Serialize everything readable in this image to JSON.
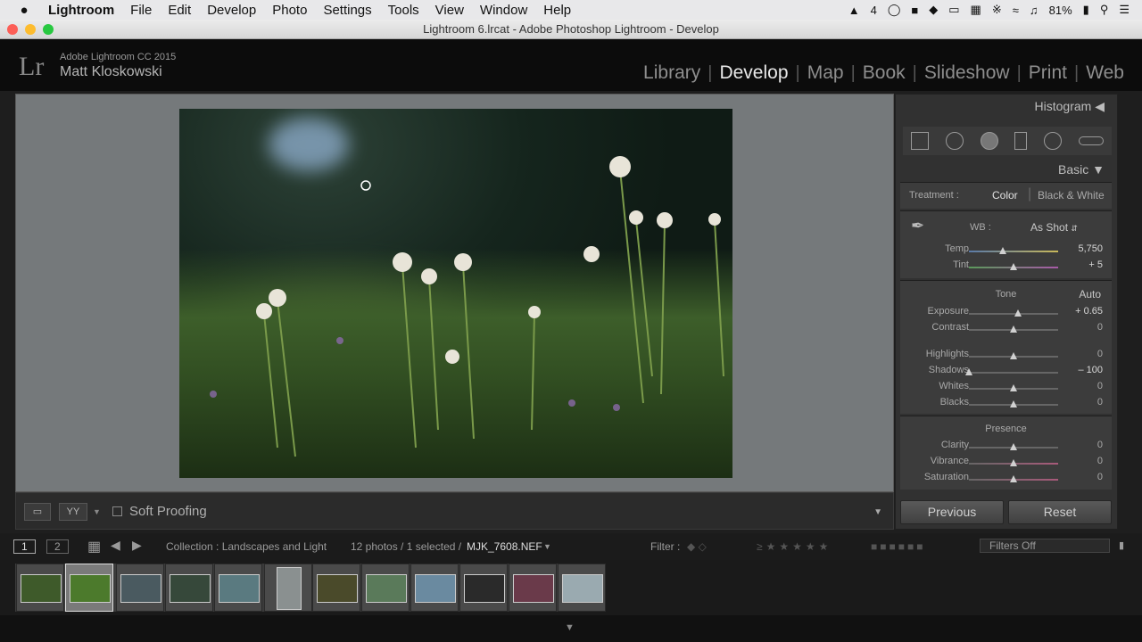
{
  "menubar": {
    "apple": "",
    "app_name": "Lightroom",
    "items": [
      "File",
      "Edit",
      "Develop",
      "Photo",
      "Settings",
      "Tools",
      "View",
      "Window",
      "Help"
    ],
    "status": {
      "adobe_count": "4",
      "battery": "81%"
    }
  },
  "window": {
    "title": "Lightroom 6.lrcat - Adobe Photoshop Lightroom - Develop"
  },
  "identity": {
    "logo": "Lr",
    "product": "Adobe Lightroom CC 2015",
    "user": "Matt Kloskowski"
  },
  "modules": [
    {
      "label": "Library",
      "active": false
    },
    {
      "label": "Develop",
      "active": true
    },
    {
      "label": "Map",
      "active": false
    },
    {
      "label": "Book",
      "active": false
    },
    {
      "label": "Slideshow",
      "active": false
    },
    {
      "label": "Print",
      "active": false
    },
    {
      "label": "Web",
      "active": false
    }
  ],
  "toolbar": {
    "soft_proofing": "Soft Proofing"
  },
  "panel": {
    "histogram": "Histogram",
    "basic": "Basic",
    "treatment_label": "Treatment :",
    "treatment_color": "Color",
    "treatment_bw": "Black & White",
    "wb_label": "WB :",
    "wb_value": "As Shot",
    "tone_title": "Tone",
    "tone_auto": "Auto",
    "presence_title": "Presence",
    "sliders": {
      "temp": {
        "label": "Temp",
        "value": "5,750",
        "pos": 0.38
      },
      "tint": {
        "label": "Tint",
        "value": "+ 5",
        "pos": 0.5
      },
      "exposure": {
        "label": "Exposure",
        "value": "+ 0.65",
        "pos": 0.55
      },
      "contrast": {
        "label": "Contrast",
        "value": "0",
        "pos": 0.5
      },
      "highlights": {
        "label": "Highlights",
        "value": "0",
        "pos": 0.5
      },
      "shadows": {
        "label": "Shadows",
        "value": "– 100",
        "pos": 0.0
      },
      "whites": {
        "label": "Whites",
        "value": "0",
        "pos": 0.5
      },
      "blacks": {
        "label": "Blacks",
        "value": "0",
        "pos": 0.5
      },
      "clarity": {
        "label": "Clarity",
        "value": "0",
        "pos": 0.5
      },
      "vibrance": {
        "label": "Vibrance",
        "value": "0",
        "pos": 0.5
      },
      "saturation": {
        "label": "Saturation",
        "value": "0",
        "pos": 0.5
      }
    },
    "previous": "Previous",
    "reset": "Reset"
  },
  "filmstrip": {
    "view1": "1",
    "view2": "2",
    "collection": "Collection : Landscapes and Light",
    "count": "12 photos / 1 selected /",
    "filename": "MJK_7608.NEF",
    "filter_label": "Filter :",
    "filters_off": "Filters Off",
    "thumb_colors": [
      "#3e5a2a",
      "#4c7a2c",
      "#4a5a60",
      "#36483a",
      "#5a7a80",
      "#8a9090",
      "#4a4a2a",
      "#5a7a5a",
      "#6a8aa0",
      "#2a2a2a",
      "#6a3a4a",
      "#9aaab0"
    ]
  }
}
